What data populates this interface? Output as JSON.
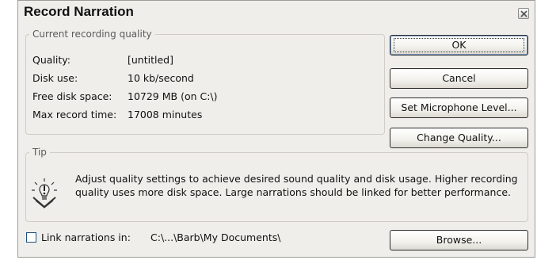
{
  "window": {
    "title": "Record Narration"
  },
  "quality_group": {
    "legend": "Current recording quality",
    "rows": [
      {
        "label": "Quality:",
        "value": "[untitled]"
      },
      {
        "label": "Disk use:",
        "value": "10 kb/second"
      },
      {
        "label": "Free disk space:",
        "value": "10729 MB (on C:\\)"
      },
      {
        "label": "Max record time:",
        "value": "17008 minutes"
      }
    ]
  },
  "buttons": {
    "ok": "OK",
    "cancel": "Cancel",
    "mic_level": "Set Microphone Level...",
    "change_quality": "Change Quality...",
    "browse": "Browse..."
  },
  "tip": {
    "legend": "Tip",
    "text": "Adjust quality settings to achieve desired sound quality and disk usage. Higher recording quality uses more disk space. Large narrations should be linked for better performance.",
    "icon": "lightbulb-tip-icon"
  },
  "link": {
    "checkbox_label": "Link narrations in:",
    "checked": false,
    "path": "C:\\...\\Barb\\My Documents\\"
  },
  "colors": {
    "dialog_bg": "#efeeea",
    "button_border": "#2d2d2d"
  }
}
